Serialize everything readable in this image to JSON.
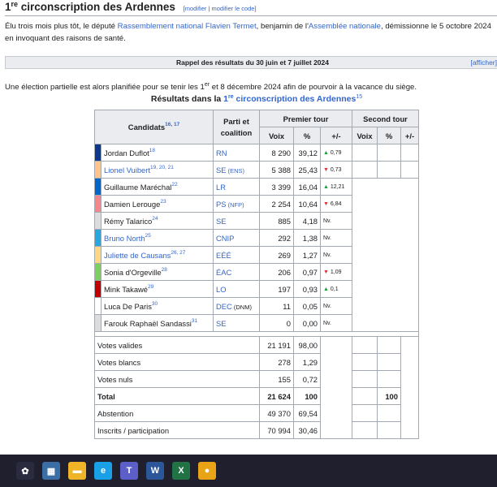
{
  "heading": {
    "num": "1",
    "sup": "re",
    "text": " circonscription des Ardennes",
    "edit_open": "[",
    "edit1": "modifier",
    "edit_sep": " | ",
    "edit2": "modifier le code",
    "edit_close": "]"
  },
  "para1": {
    "a": "Élu trois mois plus tôt, le député ",
    "link1": "Rassemblement national",
    "b": " ",
    "link2": "Flavien Termet",
    "c": ", benjamin de l'",
    "link3": "Assemblée nationale",
    "d": ", démissionne le 5 octobre 2024 en invoquant des raisons de santé."
  },
  "collapse": {
    "title": "Rappel des résultats du 30 juin et 7 juillet 2024",
    "show": "[afficher]"
  },
  "para2": {
    "a": "Une élection partielle est alors planifiée pour se tenir les 1",
    "sup": "er",
    "b": " et 8 décembre 2024 afin de pourvoir à la vacance du siège."
  },
  "caption": {
    "a": "Résultats dans la ",
    "num": "1",
    "sup": "re",
    "link": " circonscription des Ardennes",
    "ref": "15"
  },
  "headers": {
    "candidats": "Candidats",
    "candidats_ref": "16, 17",
    "parti": "Parti et coalition",
    "t1": "Premier tour",
    "t2": "Second tour",
    "voix": "Voix",
    "pct": "%",
    "evo": "+/-"
  },
  "rows": [
    {
      "color": "#0d378a",
      "name": "Jordan Duflot",
      "ref": "18",
      "link": false,
      "party": "RN",
      "coal": "",
      "voix": "8 290",
      "pct": "39,12",
      "dir": "up",
      "evo": "0,79"
    },
    {
      "color": "#ffc38c",
      "name": "Lionel Vuibert",
      "ref": "19, 20, 21",
      "link": true,
      "party": "SE",
      "coal": " (ENS)",
      "voix": "5 388",
      "pct": "25,43",
      "dir": "down",
      "evo": "0,73"
    },
    {
      "color": "#0066cc",
      "name": "Guillaume Maréchal",
      "ref": "22",
      "link": false,
      "party": "LR",
      "coal": "",
      "voix": "3 399",
      "pct": "16,04",
      "dir": "up",
      "evo": "12,21"
    },
    {
      "color": "#f7868b",
      "name": "Damien Lerouge",
      "ref": "23",
      "link": false,
      "party": "PS",
      "coal": " (NFP)",
      "voix": "2 254",
      "pct": "10,64",
      "dir": "down",
      "evo": "6,84"
    },
    {
      "color": "#dddddd",
      "name": "Rémy Talarico",
      "ref": "24",
      "link": false,
      "party": "SE",
      "coal": "",
      "voix": "885",
      "pct": "4,18",
      "dir": "",
      "evo": "Nv."
    },
    {
      "color": "#26a7df",
      "name": "Bruno North",
      "ref": "25",
      "link": true,
      "party": "CNIP",
      "coal": "",
      "voix": "292",
      "pct": "1,38",
      "dir": "",
      "evo": "Nv."
    },
    {
      "color": "#ffd782",
      "name": "Juliette de Causans",
      "ref": "26, 27",
      "link": true,
      "party": "EÉÉ",
      "coal": "",
      "voix": "269",
      "pct": "1,27",
      "dir": "",
      "evo": "Nv."
    },
    {
      "color": "#7ccf5c",
      "name": "Sonia d'Orgeville",
      "ref": "28",
      "link": false,
      "party": "ÉAC",
      "coal": "",
      "voix": "206",
      "pct": "0,97",
      "dir": "down",
      "evo": "1,09"
    },
    {
      "color": "#c00000",
      "name": "Mink Takawé",
      "ref": "29",
      "link": false,
      "party": "LO",
      "coal": "",
      "voix": "197",
      "pct": "0,93",
      "dir": "up",
      "evo": "0,1"
    },
    {
      "color": "#ffffff",
      "name": "Luca De Paris",
      "ref": "30",
      "link": false,
      "party": "DEC",
      "coal": " (DNM)",
      "voix": "11",
      "pct": "0,05",
      "dir": "",
      "evo": "Nv."
    },
    {
      "color": "#dddddd",
      "name": "Farouk Raphaël Sandassi",
      "ref": "31",
      "link": false,
      "party": "SE",
      "coal": "",
      "voix": "0",
      "pct": "0,00",
      "dir": "",
      "evo": "Nv."
    }
  ],
  "summary": [
    {
      "label": "Votes valides",
      "voix": "21 191",
      "pct": "98,00",
      "bold": false,
      "t2pct": ""
    },
    {
      "label": "Votes blancs",
      "voix": "278",
      "pct": "1,29",
      "bold": false,
      "t2pct": ""
    },
    {
      "label": "Votes nuls",
      "voix": "155",
      "pct": "0,72",
      "bold": false,
      "t2pct": ""
    },
    {
      "label": "Total",
      "voix": "21 624",
      "pct": "100",
      "bold": true,
      "t2pct": "100"
    },
    {
      "label": "Abstention",
      "voix": "49 370",
      "pct": "69,54",
      "bold": false,
      "t2pct": ""
    },
    {
      "label": "Inscrits / participation",
      "voix": "70 994",
      "pct": "30,46",
      "bold": false,
      "t2pct": ""
    }
  ],
  "arrows": {
    "up": "▲",
    "down": "▼"
  },
  "taskbar": [
    {
      "name": "start-icon",
      "color": "#2b2b40",
      "glyph": "✿"
    },
    {
      "name": "calculator-icon",
      "color": "#3a6ea5",
      "glyph": "▦"
    },
    {
      "name": "file-explorer-icon",
      "color": "#f0b429",
      "glyph": "▬"
    },
    {
      "name": "edge-icon",
      "color": "#1aa0e6",
      "glyph": "e"
    },
    {
      "name": "teams-icon",
      "color": "#5b5fc7",
      "glyph": "T"
    },
    {
      "name": "word-icon",
      "color": "#2b579a",
      "glyph": "W"
    },
    {
      "name": "excel-icon",
      "color": "#217346",
      "glyph": "X"
    },
    {
      "name": "chrome-icon",
      "color": "#e8a317",
      "glyph": "●"
    }
  ]
}
